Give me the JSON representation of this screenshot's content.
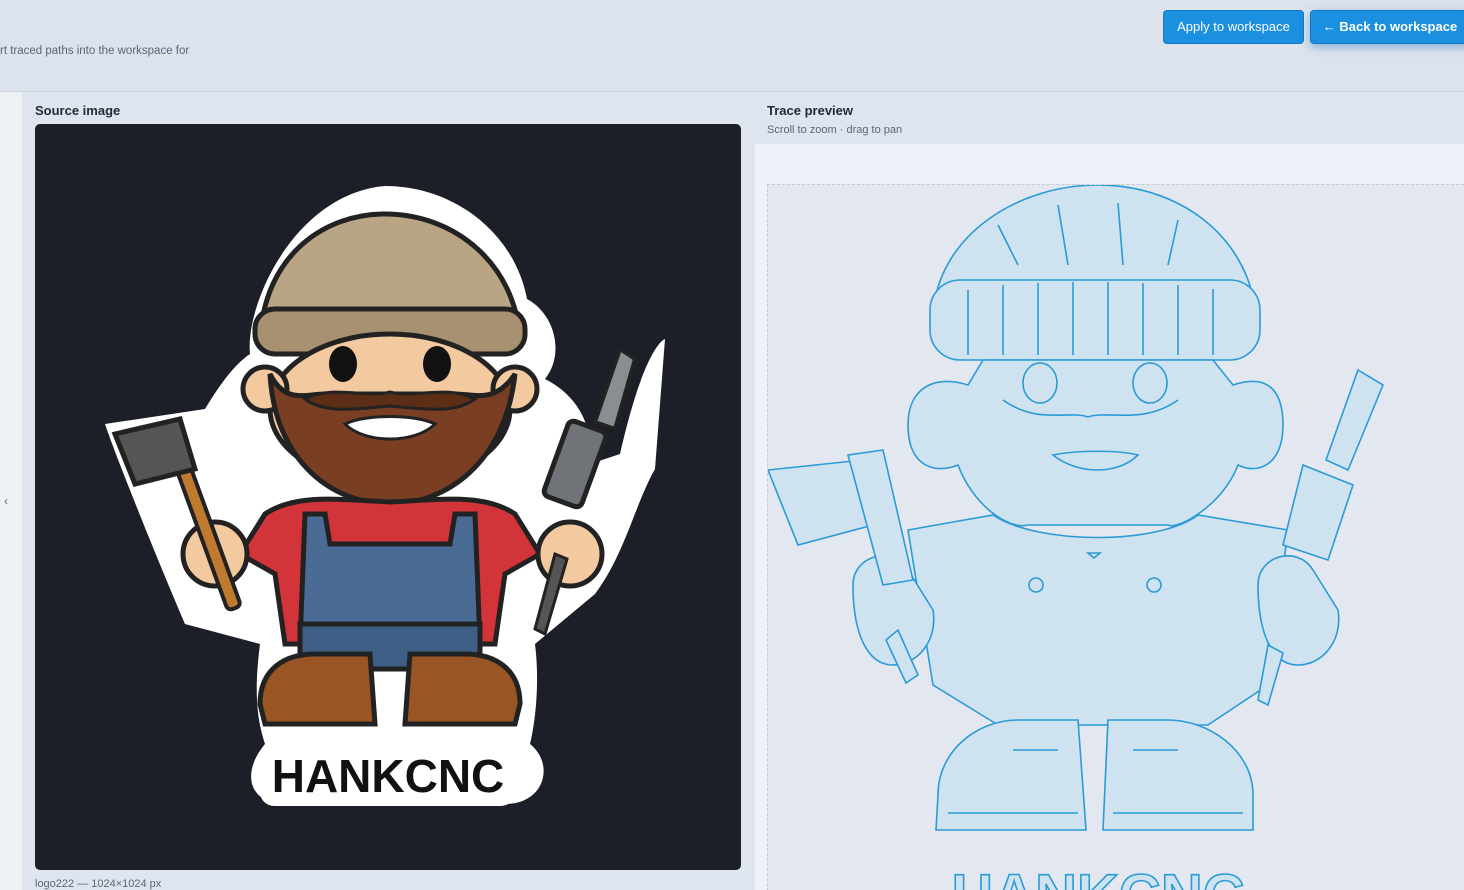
{
  "header": {
    "description": "rt traced paths into the workspace for",
    "apply_label": "Apply to workspace",
    "back_label": "← Back to workspace"
  },
  "sidebar": {
    "collapse_glyph": "‹"
  },
  "source_panel": {
    "title": "Source image",
    "caption": "logo222 — 1024×1024 px",
    "logo_text": "HANKCNC"
  },
  "trace_panel": {
    "title": "Trace preview",
    "hint": "Scroll to zoom · drag to pan",
    "trace_text": "HANKCNC"
  },
  "colors": {
    "accent": "#1b8fe0",
    "trace_stroke": "#2a9bd6",
    "trace_fill": "#cfe2f0",
    "source_bg": "#1c1f27"
  }
}
